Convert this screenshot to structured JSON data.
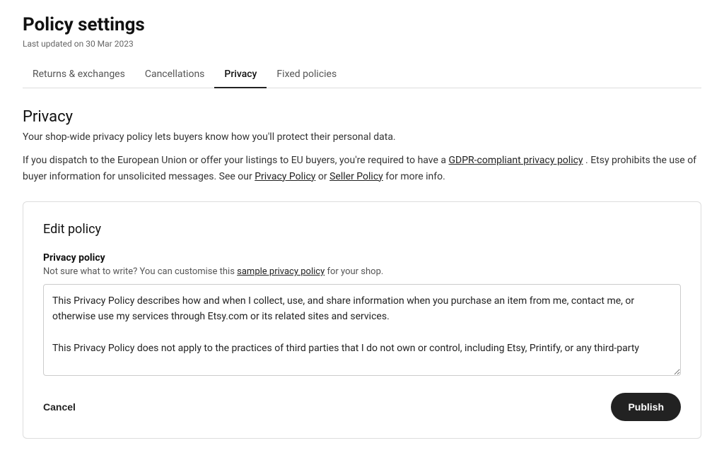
{
  "header": {
    "title": "Policy settings",
    "last_updated": "Last updated on 30 Mar 2023"
  },
  "tabs": [
    {
      "id": "returns",
      "label": "Returns & exchanges",
      "active": false
    },
    {
      "id": "cancellations",
      "label": "Cancellations",
      "active": false
    },
    {
      "id": "privacy",
      "label": "Privacy",
      "active": true
    },
    {
      "id": "fixed",
      "label": "Fixed policies",
      "active": false
    }
  ],
  "privacy": {
    "section_title": "Privacy",
    "section_desc": "Your shop-wide privacy policy lets buyers know how you'll protect their personal data.",
    "info_text_1": "If you dispatch to the European Union or offer your listings to EU buyers, you're required to have a",
    "info_link_gdpr": "GDPR-compliant privacy policy",
    "info_text_2": ". Etsy prohibits the use of buyer information for unsolicited messages. See our",
    "info_link_privacy": "Privacy Policy",
    "info_text_3": "or",
    "info_link_seller": "Seller Policy",
    "info_text_4": "for more info."
  },
  "edit_policy": {
    "card_title": "Edit policy",
    "field_label": "Privacy policy",
    "field_hint_prefix": "Not sure what to write? You can customise this",
    "field_hint_link": "sample privacy policy",
    "field_hint_suffix": "for your shop.",
    "textarea_content": "This Privacy Policy describes how and when I collect, use, and share information when you purchase an item from me, contact me, or otherwise use my services through Etsy.com or its related sites and services.\n\nThis Privacy Policy does not apply to the practices of third parties that I do not own or control, including Etsy, Printify, or any third-party",
    "cancel_label": "Cancel",
    "publish_label": "Publish"
  }
}
